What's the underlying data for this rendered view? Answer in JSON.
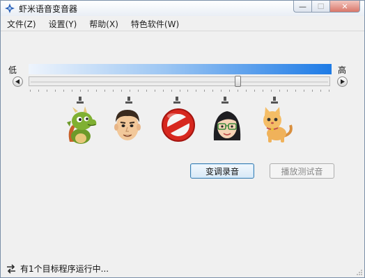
{
  "window": {
    "title": "虾米语音变音器",
    "minimize_label": "—",
    "maximize_label": "☐",
    "close_label": "✕"
  },
  "menu": [
    "文件(Z)",
    "设置(Y)",
    "帮助(X)",
    "特色软件(W)"
  ],
  "pitch": {
    "low_label": "低",
    "high_label": "高",
    "value_fraction": 0.7,
    "tick_count": 37
  },
  "presets": [
    {
      "icon": "dragon-icon"
    },
    {
      "icon": "man-face-icon"
    },
    {
      "icon": "no-effect-icon"
    },
    {
      "icon": "woman-face-icon"
    },
    {
      "icon": "cat-icon"
    }
  ],
  "buttons": {
    "change_record": "变调录音",
    "play_test": "播放测试音"
  },
  "status": {
    "text": "有1个目标程序运行中..."
  },
  "colors": {
    "gradient_start": "#eef4fc",
    "gradient_end": "#1e7be6",
    "primary_border": "#3c7fb1",
    "disabled_text": "#8a8a8a"
  }
}
